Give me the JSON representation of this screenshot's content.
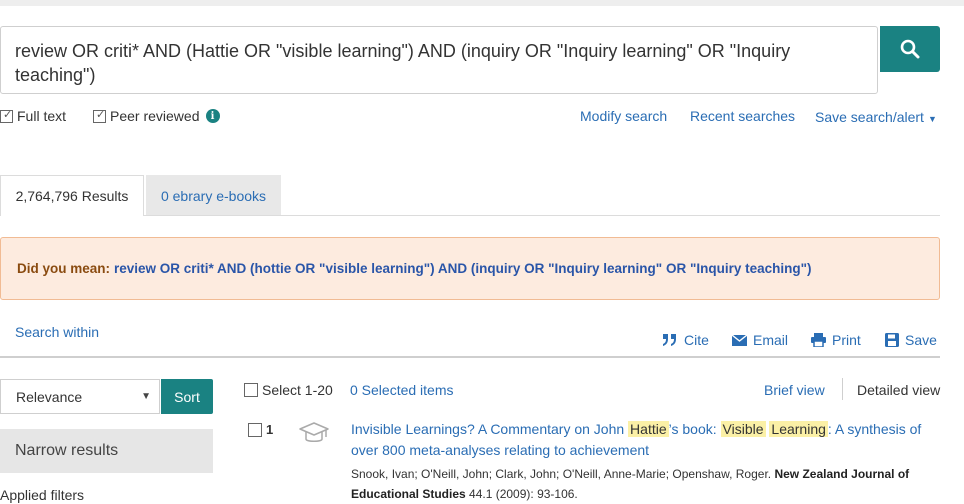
{
  "search": {
    "query": "review OR criti* AND (Hattie OR \"visible learning\") AND (inquiry OR \"Inquiry learning\" OR \"Inquiry teaching\")",
    "button_icon": "search-icon"
  },
  "options": {
    "full_text": "Full text",
    "peer_reviewed": "Peer reviewed",
    "info_icon": "i"
  },
  "links": {
    "modify": "Modify search",
    "recent": "Recent searches",
    "save_alert": "Save search/alert"
  },
  "tabs": [
    {
      "label": "2,764,796 Results",
      "active": true
    },
    {
      "label": "0 ebrary e-books",
      "active": false
    }
  ],
  "did_you_mean": {
    "label": "Did you mean:",
    "query": "review OR criti* AND (hottie OR \"visible learning\") AND (inquiry OR \"Inquiry learning\" OR \"Inquiry teaching\")"
  },
  "search_within": "Search within",
  "actions": {
    "cite": "Cite",
    "email": "Email",
    "print": "Print",
    "save": "Save"
  },
  "sort": {
    "selected": "Relevance",
    "button": "Sort"
  },
  "sidebar": {
    "narrow": "Narrow results",
    "applied": "Applied filters"
  },
  "results_bar": {
    "select": "Select 1-20",
    "selected": "0 Selected items",
    "brief": "Brief view",
    "detailed": "Detailed view"
  },
  "result1": {
    "number": "1",
    "title_parts": [
      "Invisible Learnings? A Commentary on John ",
      "Hattie",
      "’s book: ",
      "Visible",
      " ",
      "Learning",
      ": A synthesis of over 800 meta-analyses relating to achievement"
    ],
    "authors": "Snook, Ivan; O'Neill, John; Clark, John; O'Neill, Anne-Marie; Openshaw, Roger. ",
    "journal": "New Zealand Journal of Educational Studies",
    "citation": " 44.1  (2009): 93-106."
  },
  "colors": {
    "accent": "#1a8282",
    "link": "#2a6db4",
    "highlight": "#fbf0a6",
    "alert_bg": "#fdebdf"
  }
}
